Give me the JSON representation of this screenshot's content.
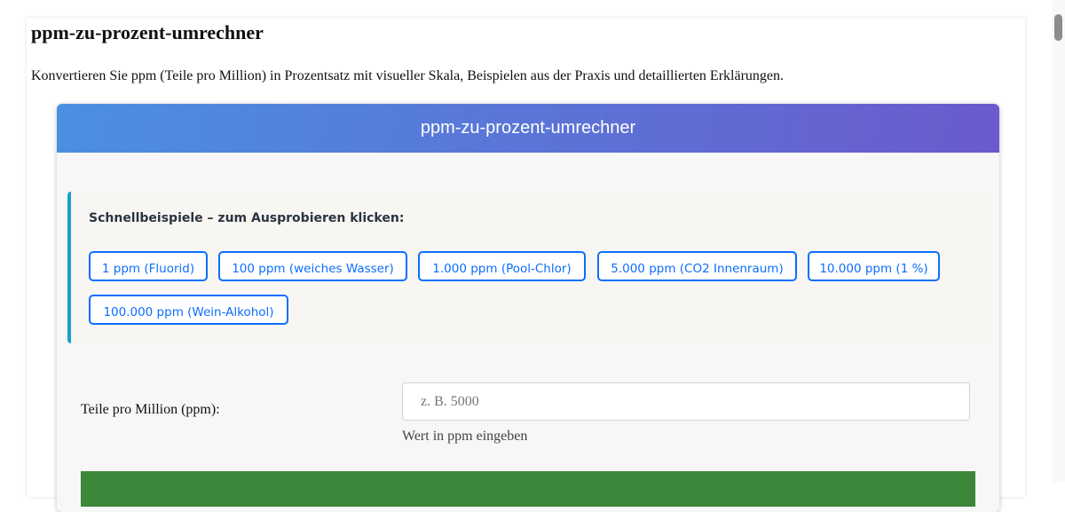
{
  "page": {
    "title": "ppm-zu-prozent-umrechner",
    "intro": "Konvertieren Sie ppm (Teile pro Million) in Prozentsatz mit visueller Skala, Beispielen aus der Praxis und detaillierten Erklärungen."
  },
  "card": {
    "header_title": "ppm-zu-prozent-umrechner",
    "header_colors": [
      "#4a90e2",
      "#6a5acd"
    ]
  },
  "examples": {
    "label": "Schnellbeispiele – zum Ausprobieren klicken:",
    "accent_color": "#17a2c8",
    "chips": [
      {
        "label": "1 ppm (Fluorid)"
      },
      {
        "label": "100 ppm (weiches Wasser)"
      },
      {
        "label": "1.000 ppm (Pool-Chlor)"
      },
      {
        "label": "5.000 ppm (CO2 Innenraum)"
      },
      {
        "label": "10.000 ppm (1 %)"
      },
      {
        "label": "100.000 ppm (Wein-Alkohol)"
      }
    ]
  },
  "input": {
    "label": "Teile pro Million (ppm):",
    "value": "",
    "placeholder": "z. B. 5000",
    "hint": "Wert in ppm eingeben"
  },
  "submit": {
    "color": "#3c873a"
  }
}
